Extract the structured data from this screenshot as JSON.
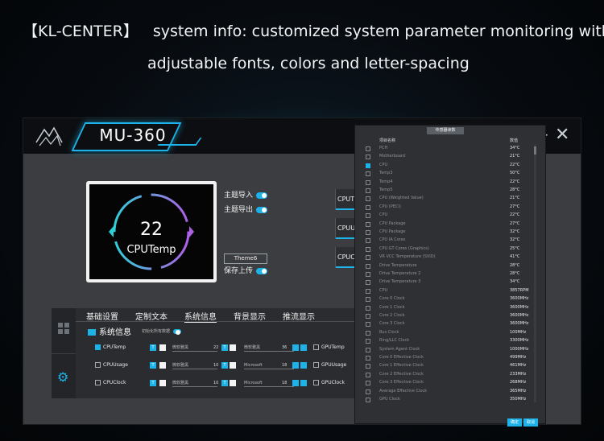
{
  "hero": {
    "bracket": "【KL-CENTER】",
    "line1": "system info: customized system parameter monitoring with",
    "line2": "adjustable fonts, colors and letter-spacing"
  },
  "app": {
    "product": "MU-360",
    "minimize_label": "−",
    "close_label": "✕",
    "preview": {
      "value": "22",
      "label": "CPUTemp"
    },
    "controls": {
      "theme_import": "主题导入",
      "theme_export": "主题导出",
      "theme_name": "Theme6",
      "save_upload": "保存上传"
    },
    "side_items": [
      "CPUT",
      "CPUU",
      "CPUC"
    ],
    "tabs": [
      "基础设置",
      "定制文本",
      "系统信息",
      "背景显示",
      "推流显示"
    ],
    "active_tab": 2,
    "section": {
      "title": "系统信息",
      "note": "初始化所有数据"
    },
    "rows": [
      {
        "label": "CPUTemp",
        "checked": true,
        "f1": "微软雅黑",
        "n1": "22",
        "f2": "微软雅黑",
        "n2": "36",
        "right": "GPUTemp"
      },
      {
        "label": "CPUUsage",
        "checked": false,
        "f1": "微软雅黑",
        "n1": "10",
        "f2": "Microsoft",
        "n2": "18",
        "right": "GPUUsage"
      },
      {
        "label": "CPUClock",
        "checked": false,
        "f1": "微软雅黑",
        "n1": "10",
        "f2": "Microsoft",
        "n2": "18",
        "right": "GPUClock"
      }
    ],
    "t_label": "T"
  },
  "sensor": {
    "title": "传感器读数",
    "col_name": "项目名称",
    "col_value": "数值",
    "ok": "确定",
    "cancel": "取消",
    "items": [
      {
        "name": "PCH",
        "value": "34°C",
        "checked": false
      },
      {
        "name": "Motherboard",
        "value": "21°C",
        "checked": false
      },
      {
        "name": "CPU",
        "value": "22°C",
        "checked": true
      },
      {
        "name": "Temp3",
        "value": "50°C",
        "checked": false
      },
      {
        "name": "Temp4",
        "value": "22°C",
        "checked": false
      },
      {
        "name": "Temp5",
        "value": "28°C",
        "checked": false
      },
      {
        "name": "CPU (Weighted Value)",
        "value": "21°C",
        "checked": false
      },
      {
        "name": "CPU (PECI)",
        "value": "27°C",
        "checked": false
      },
      {
        "name": "CPU",
        "value": "22°C",
        "checked": false
      },
      {
        "name": "CPU Package",
        "value": "27°C",
        "checked": false
      },
      {
        "name": "CPU Package",
        "value": "32°C",
        "checked": false
      },
      {
        "name": "CPU IA Cores",
        "value": "32°C",
        "checked": false
      },
      {
        "name": "CPU GT Cores (Graphics)",
        "value": "25°C",
        "checked": false
      },
      {
        "name": "VR VCC Temperature (SVID)",
        "value": "41°C",
        "checked": false
      },
      {
        "name": "Drive Temperature",
        "value": "28°C",
        "checked": false
      },
      {
        "name": "Drive Temperature 2",
        "value": "28°C",
        "checked": false
      },
      {
        "name": "Drive Temperature 3",
        "value": "34°C",
        "checked": false
      },
      {
        "name": "CPU",
        "value": "3857RPM",
        "checked": false
      },
      {
        "name": "Core 0 Clock",
        "value": "3600MHz",
        "checked": false
      },
      {
        "name": "Core 1 Clock",
        "value": "3600MHz",
        "checked": false
      },
      {
        "name": "Core 2 Clock",
        "value": "3600MHz",
        "checked": false
      },
      {
        "name": "Core 3 Clock",
        "value": "3600MHz",
        "checked": false
      },
      {
        "name": "Bus Clock",
        "value": "100MHz",
        "checked": false
      },
      {
        "name": "Ring/LLC Clock",
        "value": "3300MHz",
        "checked": false
      },
      {
        "name": "System Agent Clock",
        "value": "1000MHz",
        "checked": false
      },
      {
        "name": "Core 0 Effective Clock",
        "value": "499MHz",
        "checked": false
      },
      {
        "name": "Core 1 Effective Clock",
        "value": "461MHz",
        "checked": false
      },
      {
        "name": "Core 2 Effective Clock",
        "value": "233MHz",
        "checked": false
      },
      {
        "name": "Core 3 Effective Clock",
        "value": "268MHz",
        "checked": false
      },
      {
        "name": "Average Effective Clock",
        "value": "365MHz",
        "checked": false
      },
      {
        "name": "GPU Clock",
        "value": "350MHz",
        "checked": false
      }
    ]
  },
  "colors": {
    "accent": "#1eb3e8",
    "ring_left": "#2fd0d8",
    "ring_right": "#b060e8"
  }
}
